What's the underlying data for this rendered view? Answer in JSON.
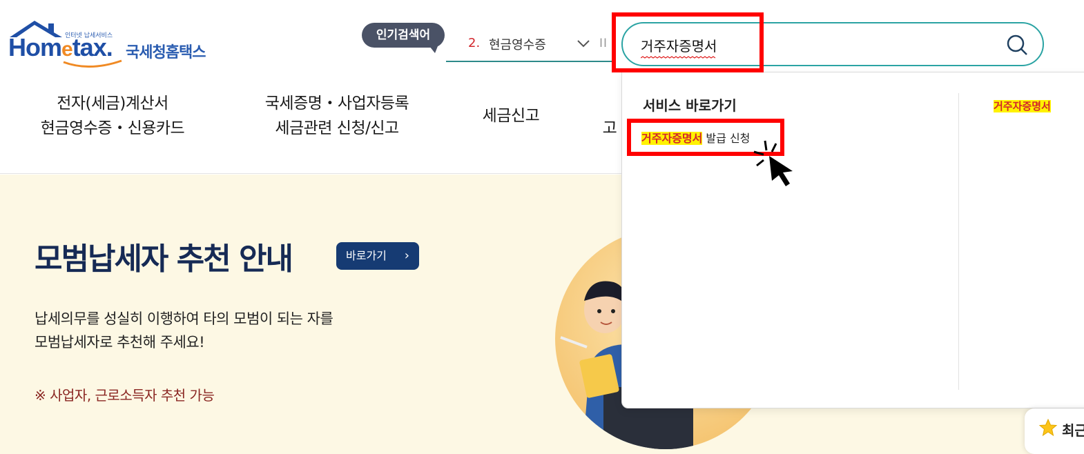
{
  "header": {
    "logo_small": "인터넷 납세서비스",
    "logo_word_main": "Hom",
    "logo_word_e": "e",
    "logo_word_tail": "tax.",
    "logo_kor": "국세청홈택스"
  },
  "popular": {
    "badge": "인기검색어",
    "rank": "2.",
    "term": "현금영수증",
    "pause": "II"
  },
  "search": {
    "value": "거주자증명서"
  },
  "nav": {
    "item1_line1": "전자(세금)계산서",
    "item1_line2": "현금영수증・신용카드",
    "item2_line1": "국세증명・사업자등록",
    "item2_line2": "세금관련 신청/신고",
    "item3": "세금신고",
    "item4_partial": "고"
  },
  "dropdown": {
    "title": "서비스 바로가기",
    "item_highlight": "거주자증명서",
    "item_rest": " 발급 신청",
    "side_highlight": "거주자증명서"
  },
  "banner": {
    "title": "모범납세자 추천 안내",
    "button": "바로가기",
    "desc_line1": "납세의무를 성실히 이행하여 타의 모범이 되는 자를",
    "desc_line2": "모범납세자로 추천해 주세요!",
    "note": "※ 사업자, 근로소득자 추천 가능"
  },
  "recent": {
    "label": "최근"
  },
  "colors": {
    "brand_blue": "#1f4fa6",
    "teal": "#2aa3a3",
    "highlight_yellow": "#fff200",
    "highlight_red": "#d2262c",
    "annotation_red": "#ff0000"
  }
}
